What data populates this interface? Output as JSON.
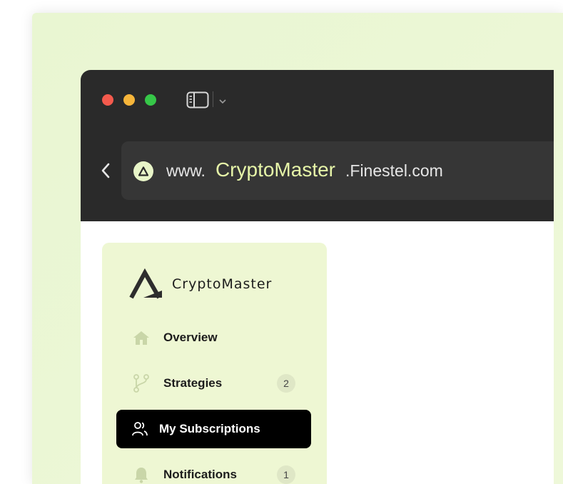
{
  "browser": {
    "window_controls": [
      "close",
      "minimize",
      "maximize"
    ],
    "url": {
      "prefix": "www.",
      "domain": "CryptoMaster",
      "suffix": ".Finestel.com"
    }
  },
  "app": {
    "brand_name": "CryptoMaster",
    "nav": [
      {
        "label": "Overview",
        "icon": "home-icon",
        "badge": null,
        "active": false
      },
      {
        "label": "Strategies",
        "icon": "branch-icon",
        "badge": "2",
        "active": false
      },
      {
        "label": "My Subscriptions",
        "icon": "users-icon",
        "badge": null,
        "active": true
      },
      {
        "label": "Notifications",
        "icon": "bell-icon",
        "badge": "1",
        "active": false
      }
    ]
  },
  "colors": {
    "background": "#e9f6d2",
    "browser_chrome": "#2a2a2a",
    "accent": "#e6f5a8",
    "active_nav": "#000000",
    "sidebar": "#eef7d3"
  }
}
